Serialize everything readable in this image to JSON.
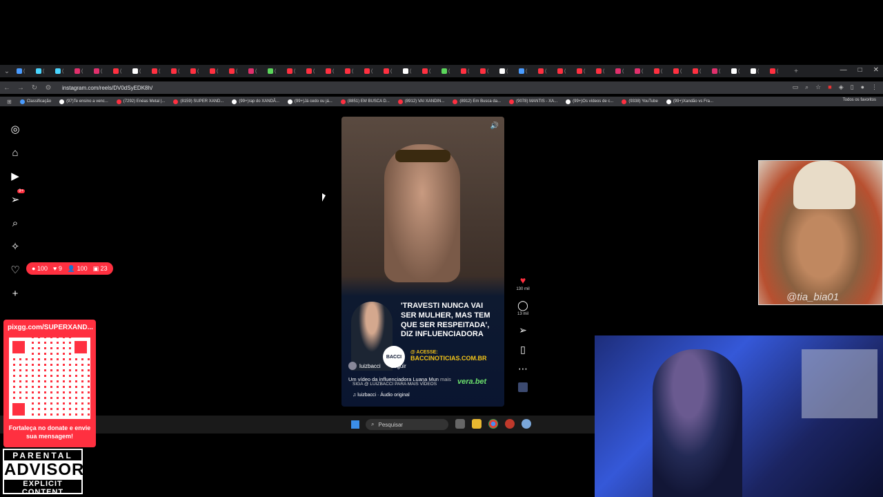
{
  "browser": {
    "url": "instagram.com/reels/DV0dSyEDK8h/",
    "tab_colors": [
      "#4a9cff",
      "#4ad6ff",
      "#4ad6ff",
      "#e1306c",
      "#e1306c",
      "#ff3040",
      "#ffffff",
      "#ff3040",
      "#ff3040",
      "#ff3040",
      "#ff3040",
      "#ff3040",
      "#e1306c",
      "#5bd65b",
      "#ff3040",
      "#ff3040",
      "#ff3040",
      "#ff3040",
      "#ff3040",
      "#ff3040",
      "#ffffff",
      "#ff3040",
      "#5bd65b",
      "#ff3040",
      "#ff3040",
      "#ffffff",
      "#4a9cff",
      "#ff3040",
      "#ff3040",
      "#ff3040",
      "#ff3040",
      "#e1306c",
      "#e1306c",
      "#ff3040",
      "#ff3040",
      "#ff3040",
      "#e1306c",
      "#ffffff",
      "#ffffff",
      "#ff3040"
    ],
    "bookmarks": [
      {
        "label": "Classificação",
        "color": "#4a9cff"
      },
      {
        "label": "(97)Te ensino a venc...",
        "color": "#ffffff"
      },
      {
        "label": "(7292) Enéas Metal |...",
        "color": "#ff3040"
      },
      {
        "label": "(8159) SUPER XAND...",
        "color": "#ff3040"
      },
      {
        "label": "(99+)rap do XANDÃ...",
        "color": "#ffffff"
      },
      {
        "label": "(99+)Já cedo ou já...",
        "color": "#ffffff"
      },
      {
        "label": "(8851) EM BUSCA D...",
        "color": "#ff3040"
      },
      {
        "label": "(8912) VAI XANDIN...",
        "color": "#ff3040"
      },
      {
        "label": "(8912) Em Busca da...",
        "color": "#ff3040"
      },
      {
        "label": "(9078) MANTIS - XA...",
        "color": "#ff3040"
      },
      {
        "label": "(99+)Os vídeos de c...",
        "color": "#ffffff"
      },
      {
        "label": "(9338) YouTube",
        "color": "#ff3040"
      },
      {
        "label": "(99+)Xandão vs Fra...",
        "color": "#ffffff"
      }
    ],
    "all_bookmarks": "Todos os favoritos"
  },
  "sidebar": {
    "notif_badge": "9+",
    "notifications": {
      "comments": "100",
      "likes": "9",
      "follows": "100",
      "tags": "23"
    }
  },
  "reel": {
    "headline": "'TRAVESTI NUNCA VAI SER MULHER, MAS TEM QUE SER RESPEITADA', DIZ INFLUENCIADORA",
    "logo": "BACCI",
    "site_label": "@ ACESSE:",
    "site": "BACCINOTICIAS.COM.BR",
    "username": "luizbacci",
    "follow": "Seguir",
    "caption": "Um vídeo da influenciadora Luana Mun",
    "more": "mais",
    "caption2": "SIGA @ LUIZBACCI PARA MAIS VÍDEOS",
    "sponsor": "vera.bet",
    "audio": "luizbacci · Áudio original"
  },
  "actions": {
    "likes": "130 mil",
    "comments": "13 mil"
  },
  "taskbar": {
    "search": "Pesquisar"
  },
  "overlays": {
    "photo_tag": "@tia_bia01",
    "pix_url": "pixgg.com/SUPERXAND...",
    "pix_text": "Fortaleça no donate e envie sua mensagem!",
    "advisory_top": "PARENTAL",
    "advisory_mid": "ADVISORY",
    "advisory_bot": "EXPLICIT CONTENT"
  }
}
